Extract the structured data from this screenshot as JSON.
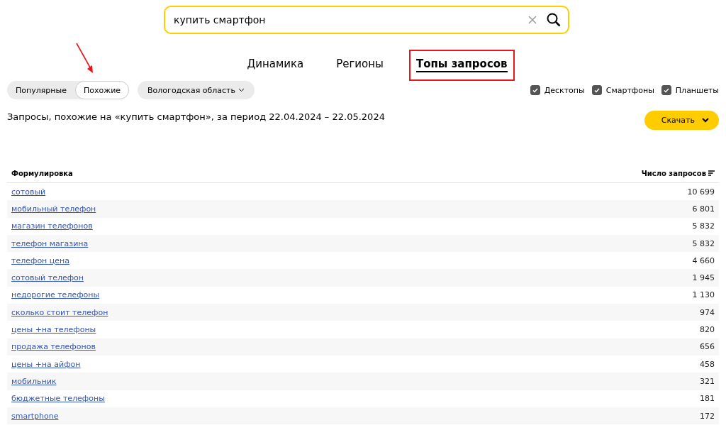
{
  "search": {
    "value": "купить смартфон"
  },
  "tabs": [
    {
      "label": "Динамика",
      "selected": false,
      "highlighted": false
    },
    {
      "label": "Регионы",
      "selected": false,
      "highlighted": false
    },
    {
      "label": "Топы запросов",
      "selected": true,
      "highlighted": true
    }
  ],
  "mode_toggle": [
    {
      "label": "Популярные",
      "selected": false,
      "pointed": false
    },
    {
      "label": "Похожие",
      "selected": true,
      "pointed": true
    }
  ],
  "region": {
    "label": "Вологодская область"
  },
  "devices": [
    {
      "label": "Десктопы",
      "checked": true
    },
    {
      "label": "Смартфоны",
      "checked": true
    },
    {
      "label": "Планшеты",
      "checked": true
    }
  ],
  "heading": "Запросы, похожие на «купить смартфон», за период 22.04.2024 – 22.05.2024",
  "download_button": "Скачать",
  "table": {
    "columns": [
      "Формулировка",
      "Число запросов"
    ],
    "rows": [
      [
        "сотовый",
        "10 699"
      ],
      [
        "мобильный телефон",
        "6 801"
      ],
      [
        "магазин телефонов",
        "5 832"
      ],
      [
        "телефон магазина",
        "5 832"
      ],
      [
        "телефон цена",
        "4 660"
      ],
      [
        "сотовый телефон",
        "1 945"
      ],
      [
        "недорогие телефоны",
        "1 130"
      ],
      [
        "сколько стоит телефон",
        "974"
      ],
      [
        "цены +на телефоны",
        "820"
      ],
      [
        "продажа телефонов",
        "656"
      ],
      [
        "цены +на айфон",
        "458"
      ],
      [
        "мобильник",
        "321"
      ],
      [
        "бюджетные телефоны",
        "181"
      ],
      [
        "smartphone",
        "172"
      ]
    ]
  }
}
